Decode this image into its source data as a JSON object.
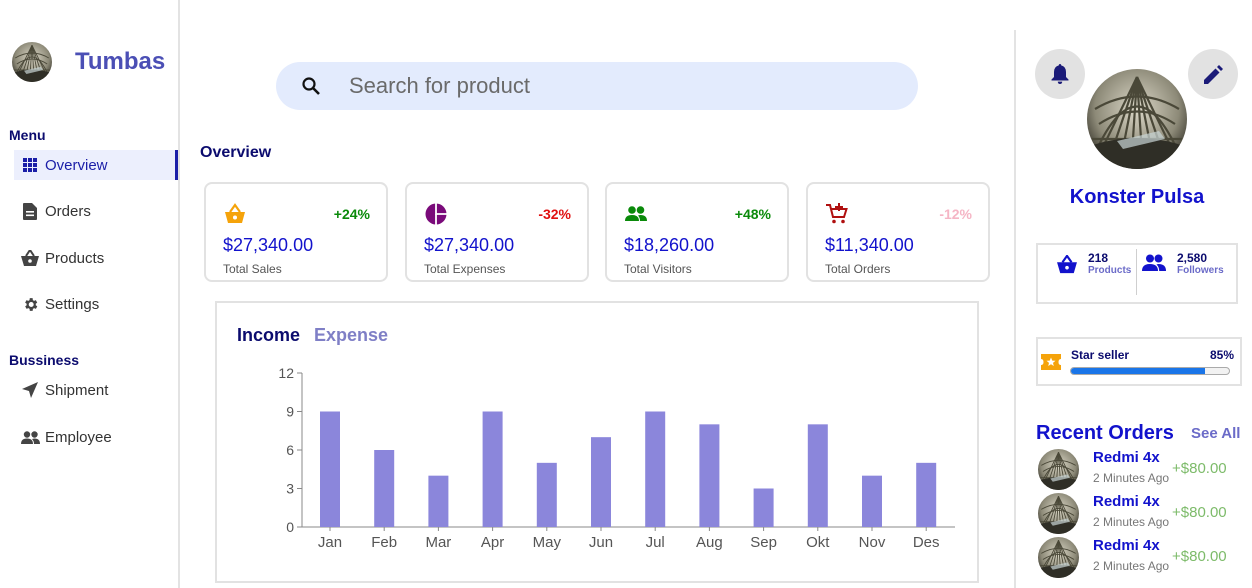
{
  "brand": {
    "name": "Tumbas",
    "avatar_icon": "glass-dome-image"
  },
  "sidebar": {
    "menu_heading": "Menu",
    "business_heading": "Bussiness",
    "items": [
      {
        "label": "Overview",
        "icon": "grid-icon",
        "active": true
      },
      {
        "label": "Orders",
        "icon": "document-icon"
      },
      {
        "label": "Products",
        "icon": "basket-icon"
      },
      {
        "label": "Settings",
        "icon": "gear-icon"
      }
    ],
    "business_items": [
      {
        "label": "Shipment",
        "icon": "send-icon"
      },
      {
        "label": "Employee",
        "icon": "people-icon"
      }
    ]
  },
  "search": {
    "placeholder": "Search for product"
  },
  "overview": {
    "title": "Overview",
    "cards": [
      {
        "value": "$27,340.00",
        "label": "Total Sales",
        "delta": "+24%",
        "delta_color": "#0a8a0a",
        "icon": "basket-icon",
        "icon_color": "#f5a30a"
      },
      {
        "value": "$27,340.00",
        "label": "Total Expenses",
        "delta": "-32%",
        "delta_color": "#e01010",
        "icon": "pie-chart-icon",
        "icon_color": "#7a0a7a"
      },
      {
        "value": "$18,260.00",
        "label": "Total Visitors",
        "delta": "+48%",
        "delta_color": "#0a8a0a",
        "icon": "people-icon",
        "icon_color": "#0a8a0a"
      },
      {
        "value": "$11,340.00",
        "label": "Total Orders",
        "delta": "-12%",
        "delta_color": "#f5b5c5",
        "icon": "cart-add-icon",
        "icon_color": "#b01010"
      }
    ]
  },
  "chart_tabs": {
    "income": "Income",
    "expense": "Expense"
  },
  "chart_data": {
    "type": "bar",
    "categories": [
      "Jan",
      "Feb",
      "Mar",
      "Apr",
      "May",
      "Jun",
      "Jul",
      "Aug",
      "Sep",
      "Okt",
      "Nov",
      "Des"
    ],
    "values": [
      9,
      6,
      4,
      9,
      5,
      7,
      9,
      8,
      3,
      8,
      4,
      5
    ],
    "ylim": [
      0,
      12
    ],
    "yticks": [
      0,
      3,
      6,
      9,
      12
    ],
    "bar_color": "#8b86db",
    "title": "",
    "xlabel": "",
    "ylabel": ""
  },
  "profile": {
    "name": "Konster Pulsa",
    "products_count": "218",
    "products_label": "Products",
    "followers_count": "2,580",
    "followers_label": "Followers"
  },
  "seller": {
    "label": "Star seller",
    "percent": "85%",
    "progress": 0.85
  },
  "recent_orders": {
    "title": "Recent Orders",
    "see_all": "See All",
    "items": [
      {
        "name": "Redmi 4x",
        "time": "2 Minutes Ago",
        "price": "+$80.00"
      },
      {
        "name": "Redmi 4x",
        "time": "2 Minutes Ago",
        "price": "+$80.00"
      },
      {
        "name": "Redmi 4x",
        "time": "2 Minutes Ago",
        "price": "+$80.00"
      }
    ]
  },
  "colors": {
    "accent": "#1212cc",
    "navy": "#0b0b6e",
    "search_bg": "#e3ebfd"
  }
}
